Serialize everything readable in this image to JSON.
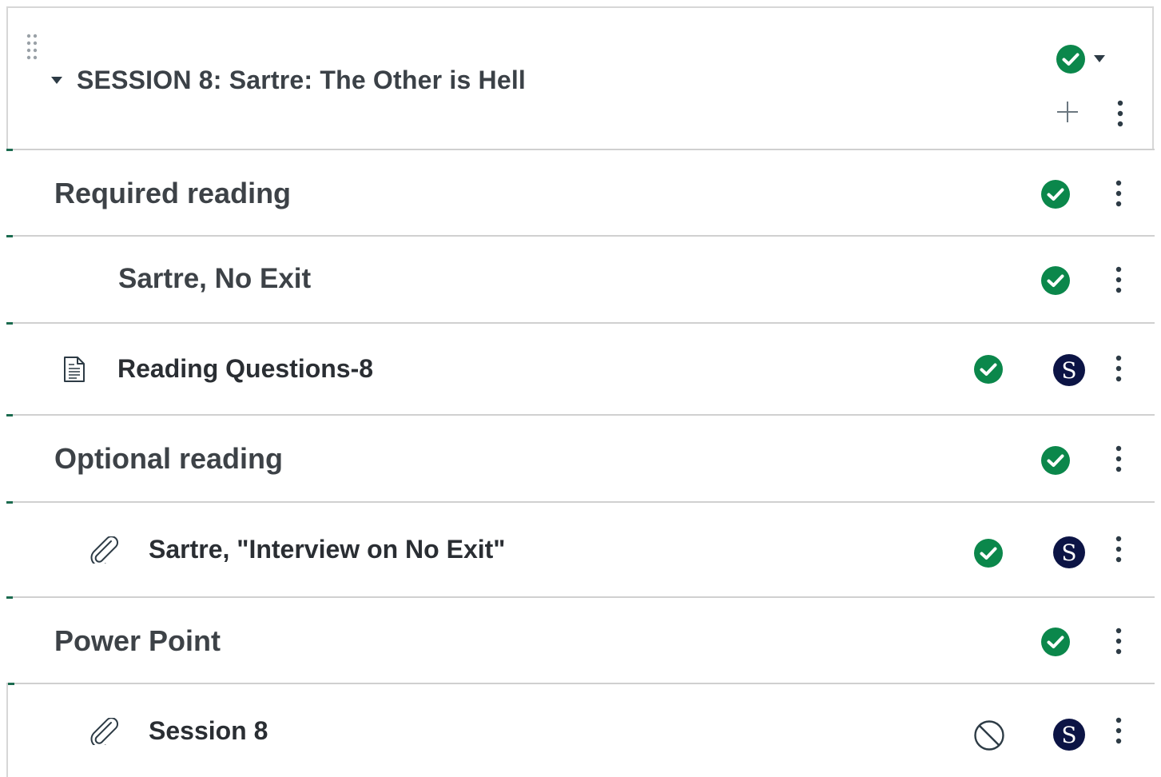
{
  "module": {
    "title": "SESSION 8: Sartre: The Other is Hell",
    "status": "published"
  },
  "rows": [
    {
      "type": "subheader",
      "label": "Required reading",
      "status": "published"
    },
    {
      "type": "subheader",
      "label": "Sartre, No Exit",
      "status": "published"
    },
    {
      "type": "assignment",
      "label": "Reading Questions-8",
      "status": "published",
      "assignee": "S"
    },
    {
      "type": "subheader",
      "label": "Optional reading",
      "status": "published"
    },
    {
      "type": "attachment",
      "label": "Sartre, \"Interview on No Exit\"",
      "status": "published",
      "assignee": "S"
    },
    {
      "type": "subheader",
      "label": "Power Point",
      "status": "published"
    },
    {
      "type": "attachment",
      "label": "Session 8",
      "status": "unpublished",
      "assignee": "S"
    }
  ],
  "colors": {
    "published_green": "#0b874b",
    "avatar_navy": "#0c1445",
    "text_dark": "#2d3b45"
  },
  "icons": {
    "drag": "drag-handle-icon",
    "collapse": "caret-down-icon",
    "published": "check-circle-icon",
    "unpublished": "no-circle-icon",
    "add": "plus-icon",
    "menu": "kebab-menu-icon",
    "assignment": "document-icon",
    "attachment": "paperclip-icon",
    "avatar": "s-avatar-icon"
  }
}
